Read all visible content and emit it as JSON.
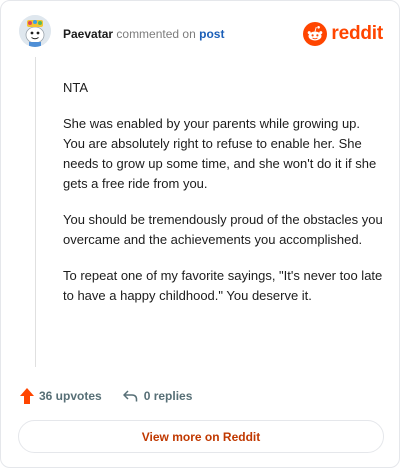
{
  "header": {
    "author": "Paevatar",
    "action": "commented on",
    "post_label": "post",
    "brand_name": "reddit"
  },
  "comment": {
    "paragraphs": [
      "NTA",
      "She was enabled by your parents while growing up. You are absolutely right to refuse to enable her. She needs to grow up some time, and she won't do it if she gets a free ride from you.",
      "You should be tremendously proud of the obstacles you overcame and the achievements you accomplished.",
      "To repeat one of my favorite sayings, \"It's never too late to have a happy childhood.\" You deserve it."
    ]
  },
  "footer": {
    "upvotes_label": "36 upvotes",
    "replies_label": "0 replies"
  },
  "actions": {
    "view_more_label": "View more on Reddit"
  },
  "colors": {
    "brand": "#ff4500",
    "link": "#1b5fb8",
    "view_more_text": "#c03800",
    "muted": "#7c7c7c"
  },
  "icons": {
    "avatar": "avatar",
    "brand": "reddit-snoo-icon",
    "upvote": "upvote-arrow-icon",
    "reply": "reply-arrow-icon"
  }
}
